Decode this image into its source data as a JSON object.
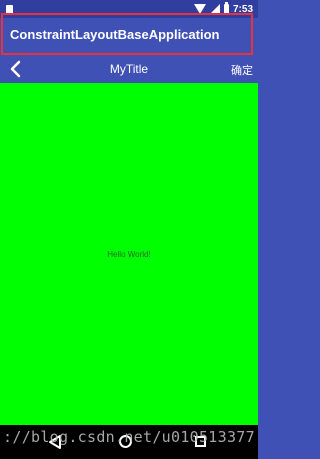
{
  "status_bar": {
    "time": "7:53"
  },
  "app_bar": {
    "title": "ConstraintLayoutBaseApplication"
  },
  "custom_toolbar": {
    "back_glyph": "‹",
    "title": "MyTitle",
    "confirm_label": "确定"
  },
  "content": {
    "text": "Hello World!",
    "background": "#00ff00"
  },
  "watermark": {
    "text": "://blog.csdn.net/u010513377"
  },
  "colors": {
    "primary": "#3f51b5",
    "primary_dark": "#303f9f",
    "highlight": "#e8323c"
  },
  "icons": [
    "notification-icon",
    "wifi-icon",
    "signal-icon",
    "battery-icon",
    "back-arrow-icon",
    "nav-back-icon",
    "nav-home-icon",
    "nav-recents-icon"
  ]
}
